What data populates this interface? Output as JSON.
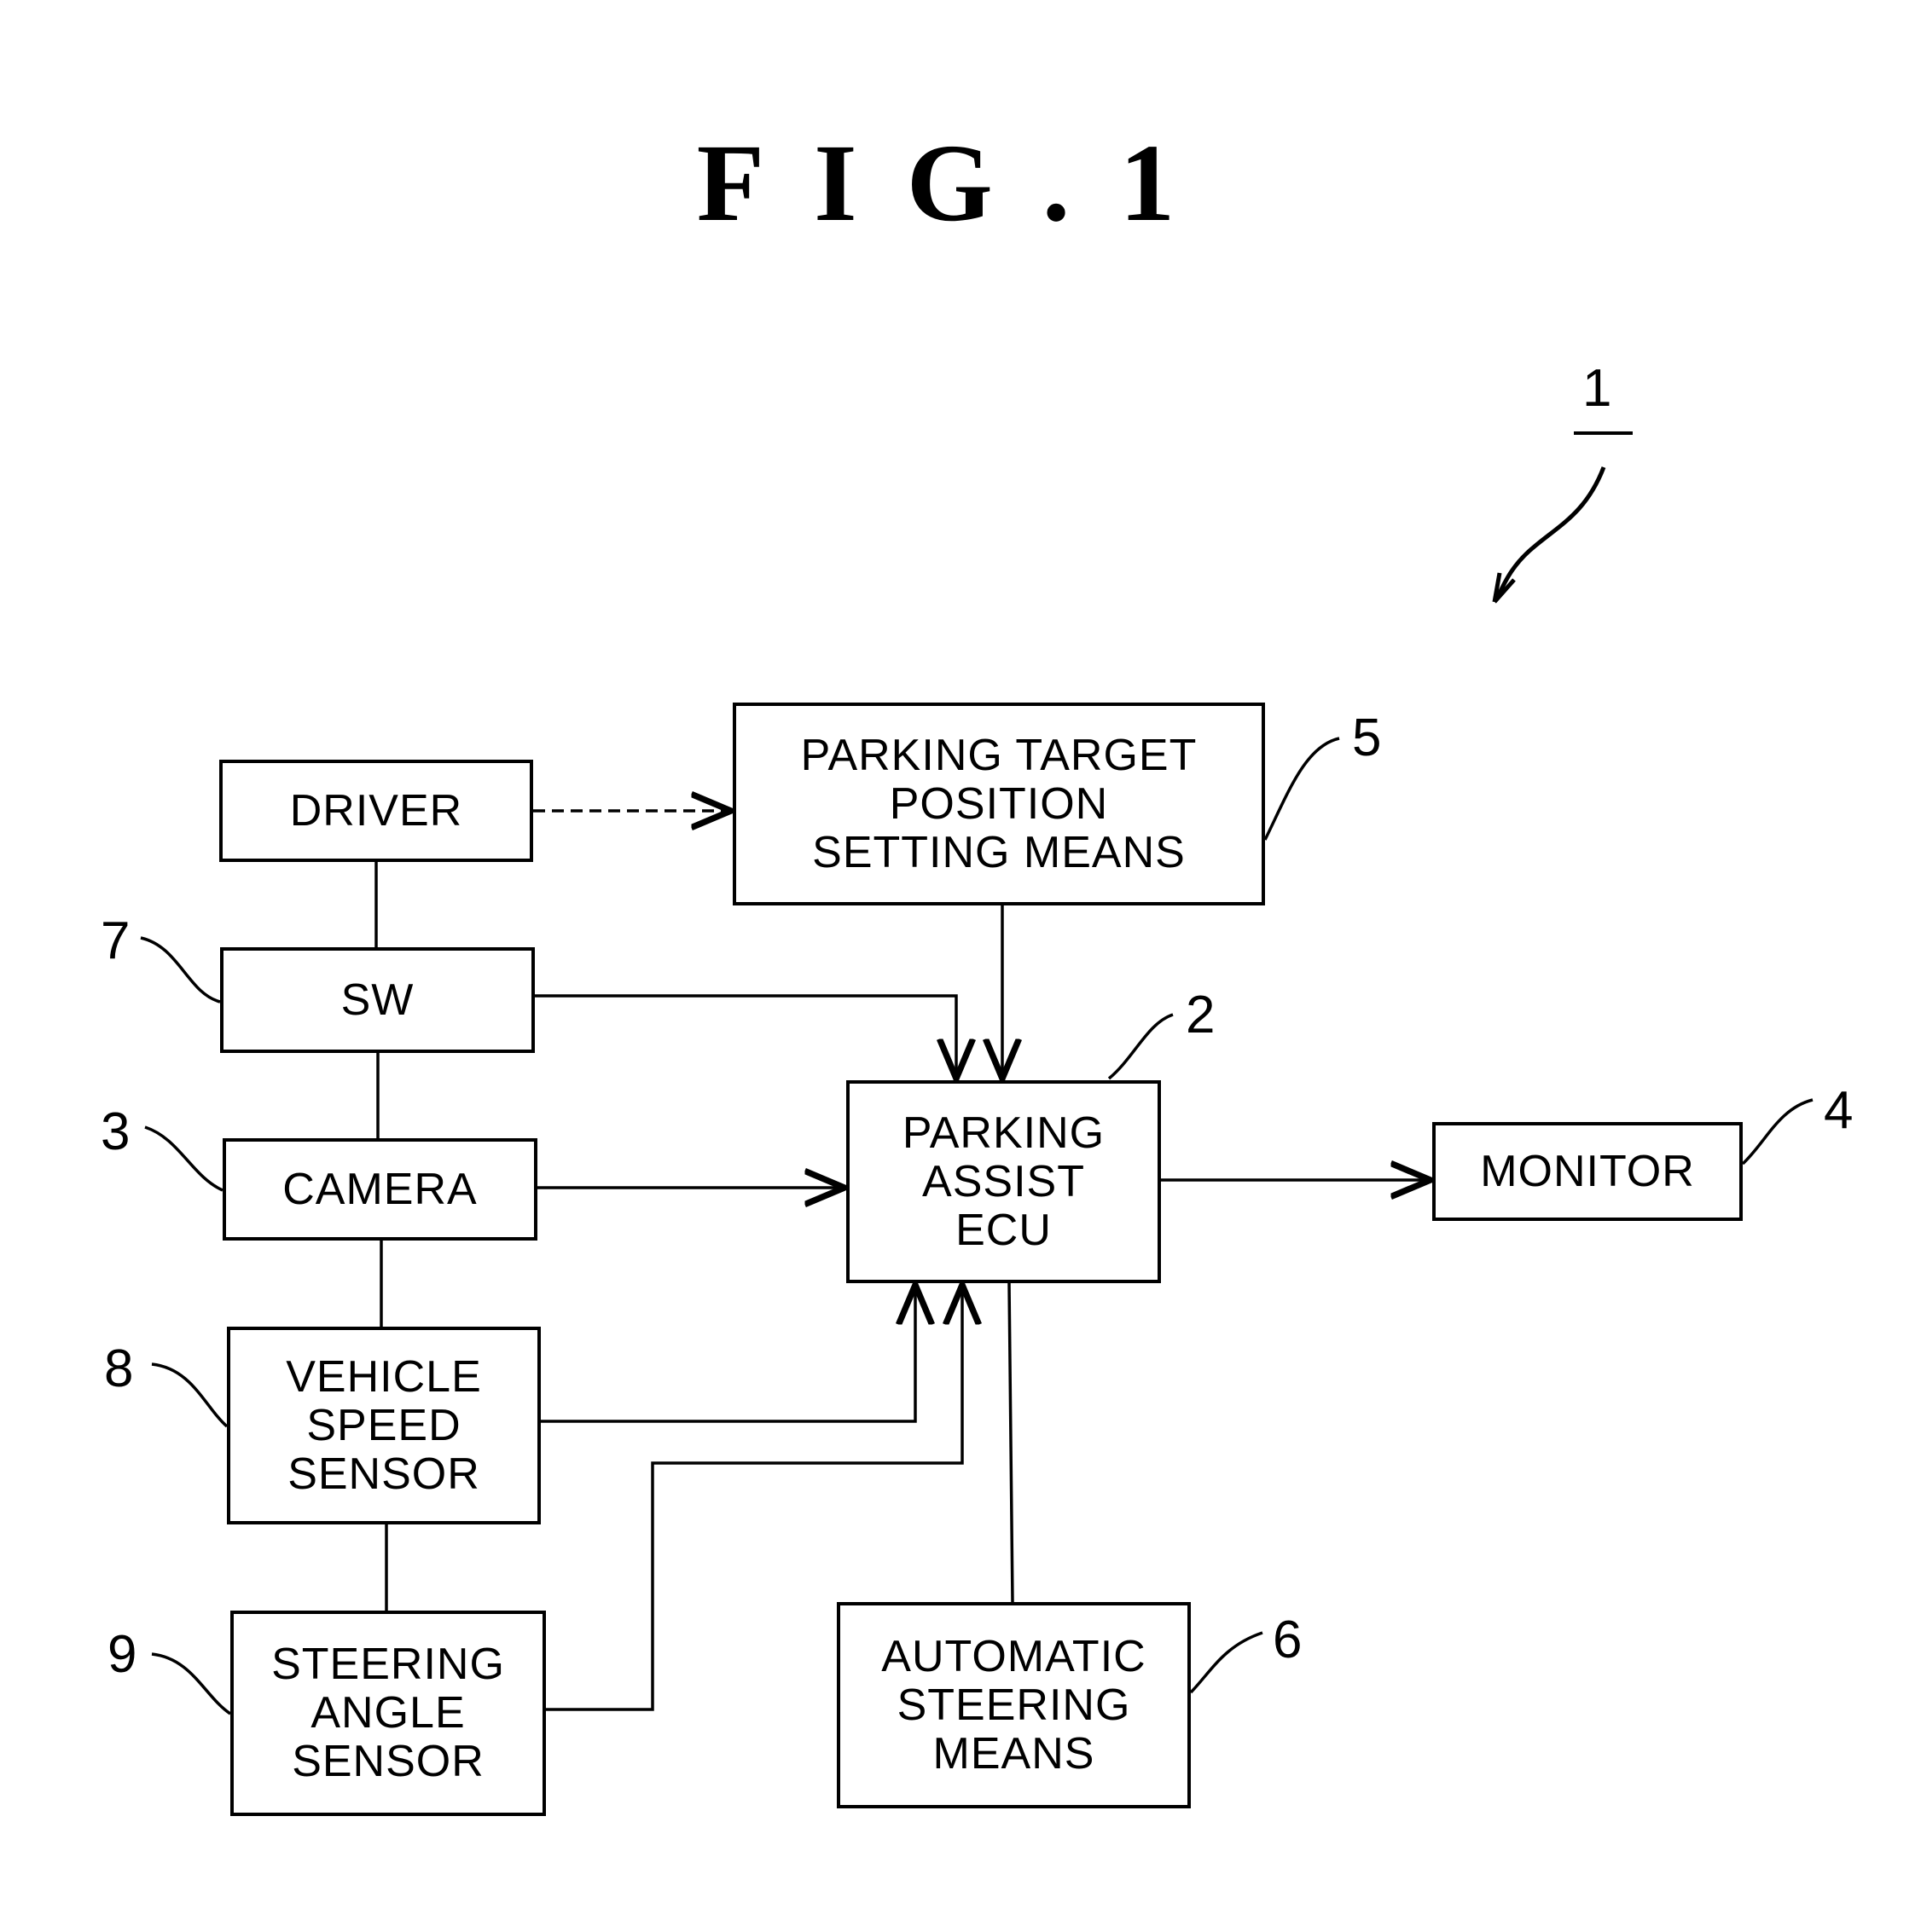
{
  "figure": {
    "title": "FIG.1",
    "system_ref": "1"
  },
  "blocks": {
    "driver": {
      "lines": [
        "DRIVER"
      ],
      "ref": ""
    },
    "target": {
      "lines": [
        "PARKING TARGET",
        "POSITION",
        "SETTING MEANS"
      ],
      "ref": "5"
    },
    "sw": {
      "lines": [
        "SW"
      ],
      "ref": "7"
    },
    "camera": {
      "lines": [
        "CAMERA"
      ],
      "ref": "3"
    },
    "speed": {
      "lines": [
        "VEHICLE",
        "SPEED",
        "SENSOR"
      ],
      "ref": "8"
    },
    "steer_angle": {
      "lines": [
        "STEERING",
        "ANGLE",
        "SENSOR"
      ],
      "ref": "9"
    },
    "ecu": {
      "lines": [
        "PARKING",
        "ASSIST",
        "ECU"
      ],
      "ref": "2"
    },
    "monitor": {
      "lines": [
        "MONITOR"
      ],
      "ref": "4"
    },
    "auto_steer": {
      "lines": [
        "AUTOMATIC",
        "STEERING",
        "MEANS"
      ],
      "ref": "6"
    }
  },
  "connections": [
    {
      "from": "driver",
      "to": "target",
      "style": "dashed",
      "arrow": true
    },
    {
      "from": "driver",
      "to": "sw",
      "style": "solid",
      "arrow": false
    },
    {
      "from": "sw",
      "to": "camera",
      "style": "solid",
      "arrow": false
    },
    {
      "from": "camera",
      "to": "speed",
      "style": "solid",
      "arrow": false
    },
    {
      "from": "speed",
      "to": "steer_angle",
      "style": "solid",
      "arrow": false
    },
    {
      "from": "sw",
      "to": "ecu",
      "style": "solid",
      "arrow": true
    },
    {
      "from": "target",
      "to": "ecu",
      "style": "solid",
      "arrow": true
    },
    {
      "from": "camera",
      "to": "ecu",
      "style": "solid",
      "arrow": true
    },
    {
      "from": "speed",
      "to": "ecu",
      "style": "solid",
      "arrow": true
    },
    {
      "from": "steer_angle",
      "to": "ecu",
      "style": "solid",
      "arrow": true
    },
    {
      "from": "ecu",
      "to": "monitor",
      "style": "solid",
      "arrow": true
    },
    {
      "from": "ecu",
      "to": "auto_steer",
      "style": "solid",
      "arrow": false
    }
  ]
}
